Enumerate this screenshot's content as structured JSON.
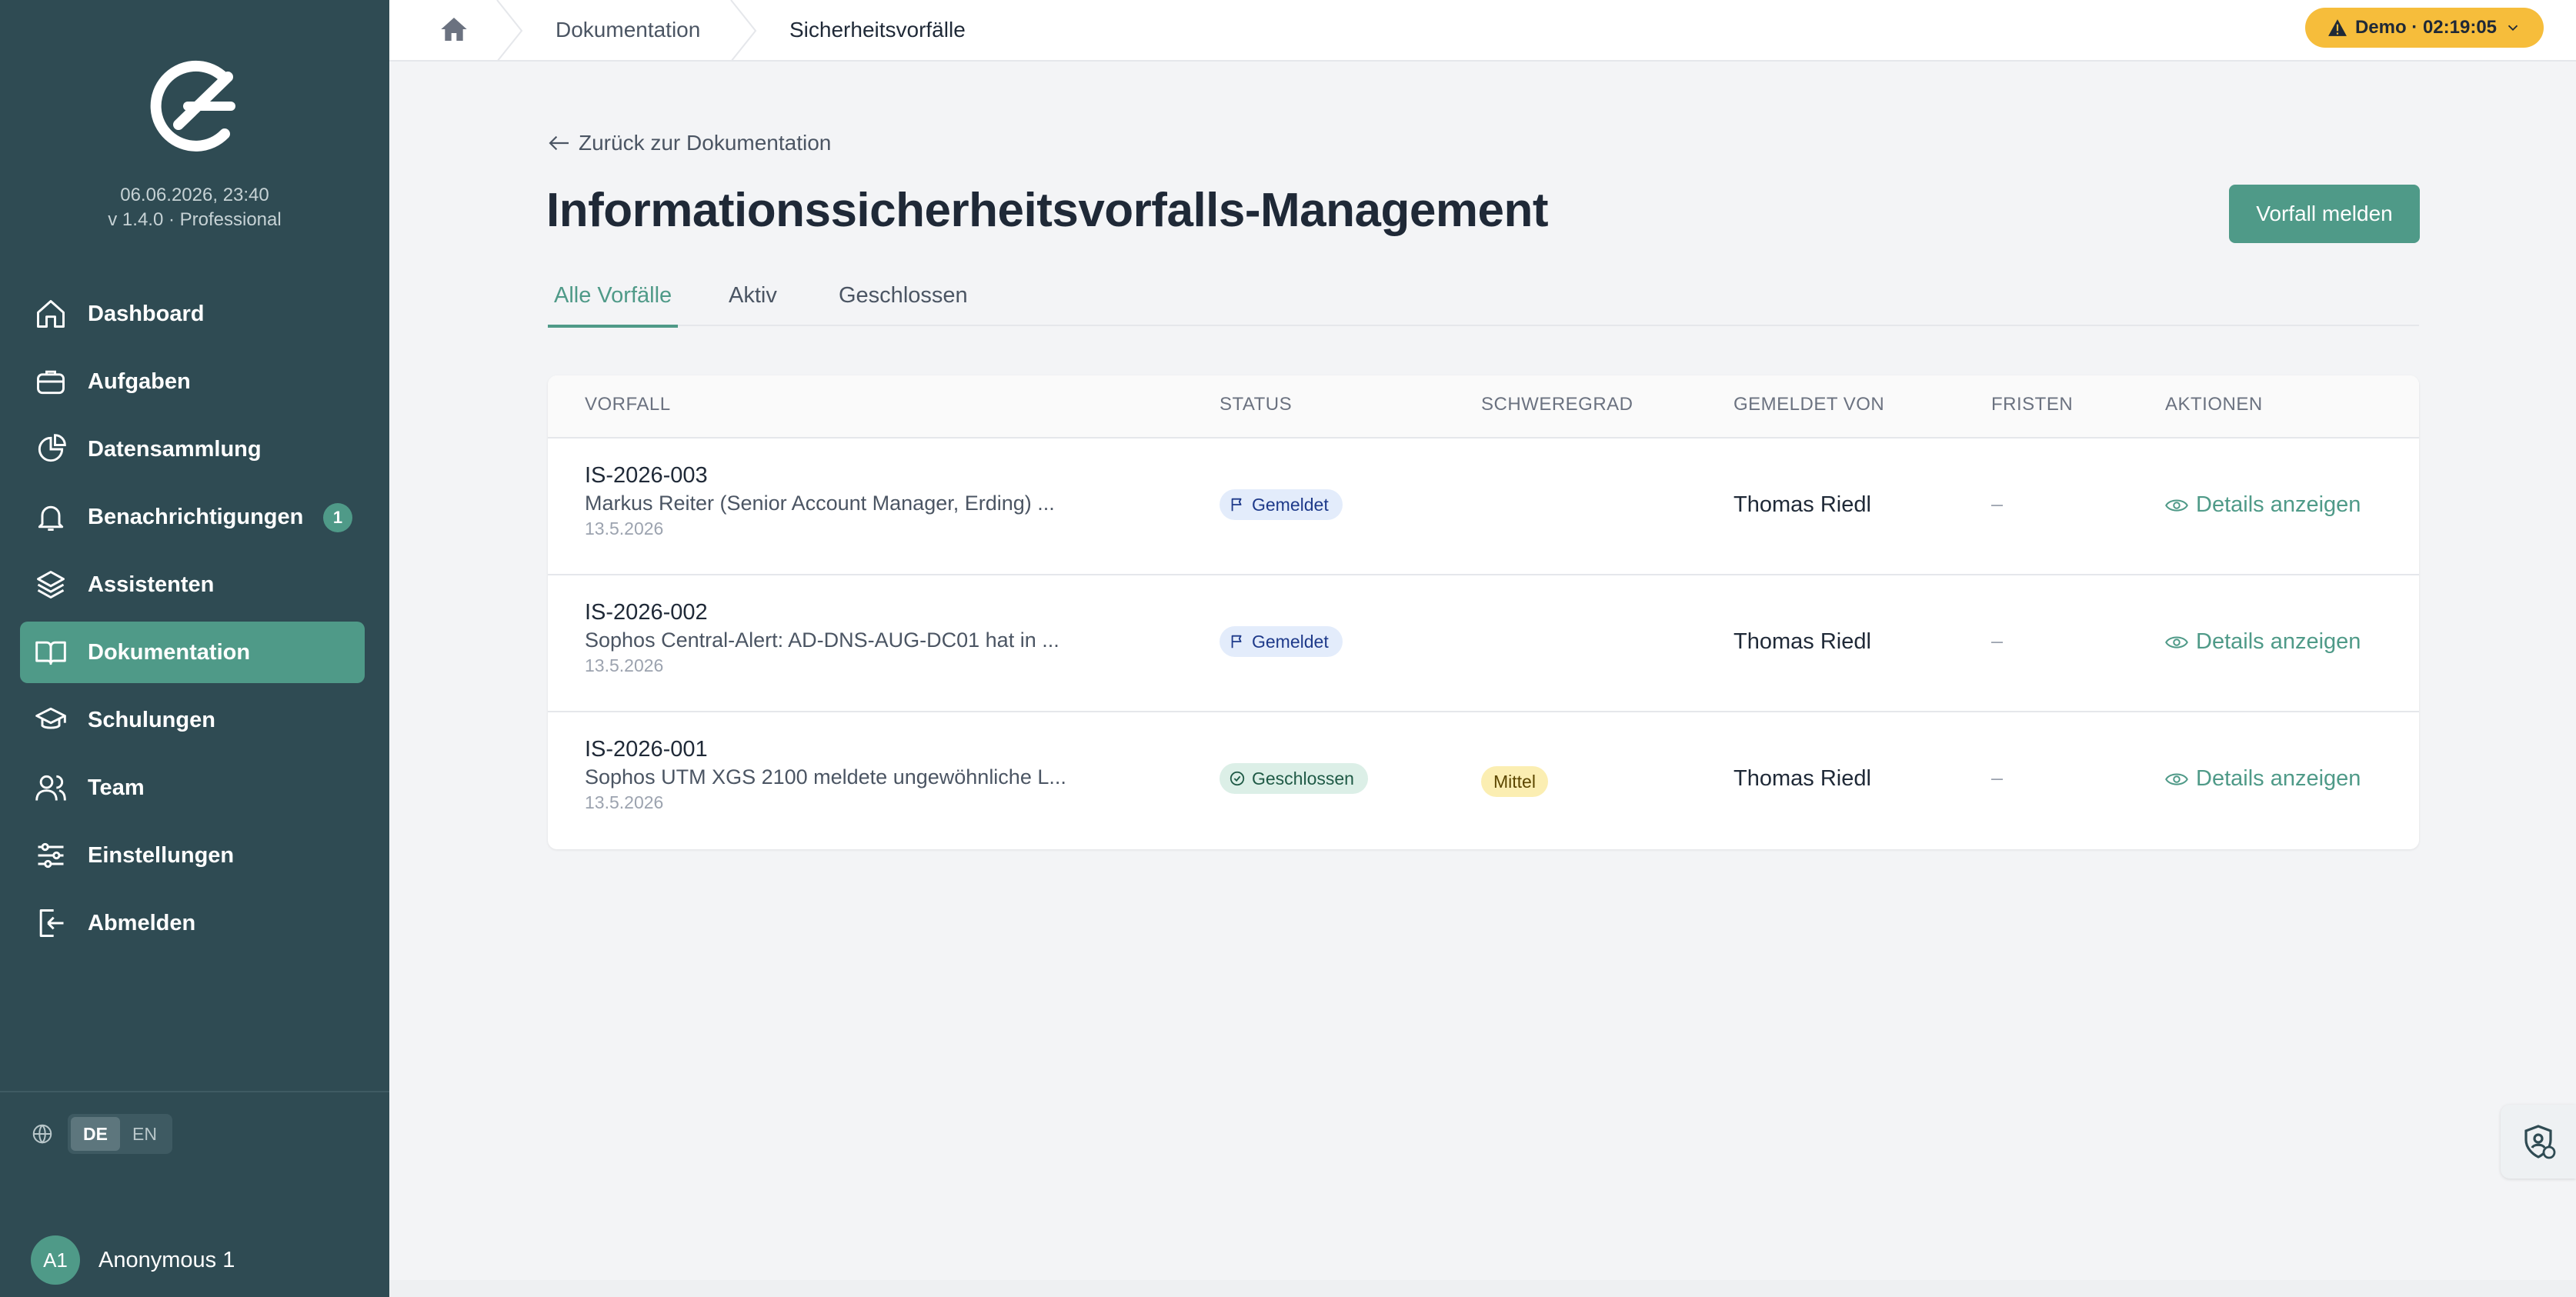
{
  "sidebar": {
    "datetime": "06.06.2026, 23:40",
    "version": "v 1.4.0 · Professional",
    "items": [
      {
        "label": "Dashboard",
        "icon": "home-icon"
      },
      {
        "label": "Aufgaben",
        "icon": "briefcase-icon"
      },
      {
        "label": "Datensammlung",
        "icon": "pie-chart-icon"
      },
      {
        "label": "Benachrichtigungen",
        "icon": "bell-icon",
        "badge": "1"
      },
      {
        "label": "Assistenten",
        "icon": "layers-icon"
      },
      {
        "label": "Dokumentation",
        "icon": "book-icon",
        "active": true
      },
      {
        "label": "Schulungen",
        "icon": "graduation-cap-icon"
      },
      {
        "label": "Team",
        "icon": "users-icon"
      },
      {
        "label": "Einstellungen",
        "icon": "sliders-icon"
      },
      {
        "label": "Abmelden",
        "icon": "logout-icon"
      }
    ],
    "languages": [
      "DE",
      "EN"
    ],
    "active_language": "DE",
    "user": {
      "initials": "A1",
      "name": "Anonymous 1"
    }
  },
  "topbar": {
    "breadcrumb": [
      "Dokumentation",
      "Sicherheitsvorfälle"
    ],
    "demo_label": "Demo · 02:19:05"
  },
  "main": {
    "back_link": "Zurück zur Dokumentation",
    "title": "Informationssicherheitsvorfalls-Management",
    "report_button": "Vorfall melden",
    "tabs": [
      "Alle Vorfälle",
      "Aktiv",
      "Geschlossen"
    ],
    "table": {
      "headers": [
        "VORFALL",
        "STATUS",
        "SCHWEREGRAD",
        "GEMELDET VON",
        "FRISTEN",
        "AKTIONEN"
      ],
      "rows": [
        {
          "id": "IS-2026-003",
          "description": "Markus Reiter (Senior Account Manager, Erding) ...",
          "date": "13.5.2026",
          "status": "Gemeldet",
          "severity": "",
          "reporter": "Thomas Riedl",
          "deadline": "–",
          "action": "Details anzeigen"
        },
        {
          "id": "IS-2026-002",
          "description": "Sophos Central-Alert: AD-DNS-AUG-DC01 hat in ...",
          "date": "13.5.2026",
          "status": "Gemeldet",
          "severity": "",
          "reporter": "Thomas Riedl",
          "deadline": "–",
          "action": "Details anzeigen"
        },
        {
          "id": "IS-2026-001",
          "description": "Sophos UTM XGS 2100 meldete ungewöhnliche L...",
          "date": "13.5.2026",
          "status": "Geschlossen",
          "severity": "Mittel",
          "reporter": "Thomas Riedl",
          "deadline": "–",
          "action": "Details anzeigen"
        }
      ]
    }
  },
  "colors": {
    "sidebar_bg": "#2f4b53",
    "accent": "#4f9a88",
    "demo_pill": "#f6bd3b"
  }
}
